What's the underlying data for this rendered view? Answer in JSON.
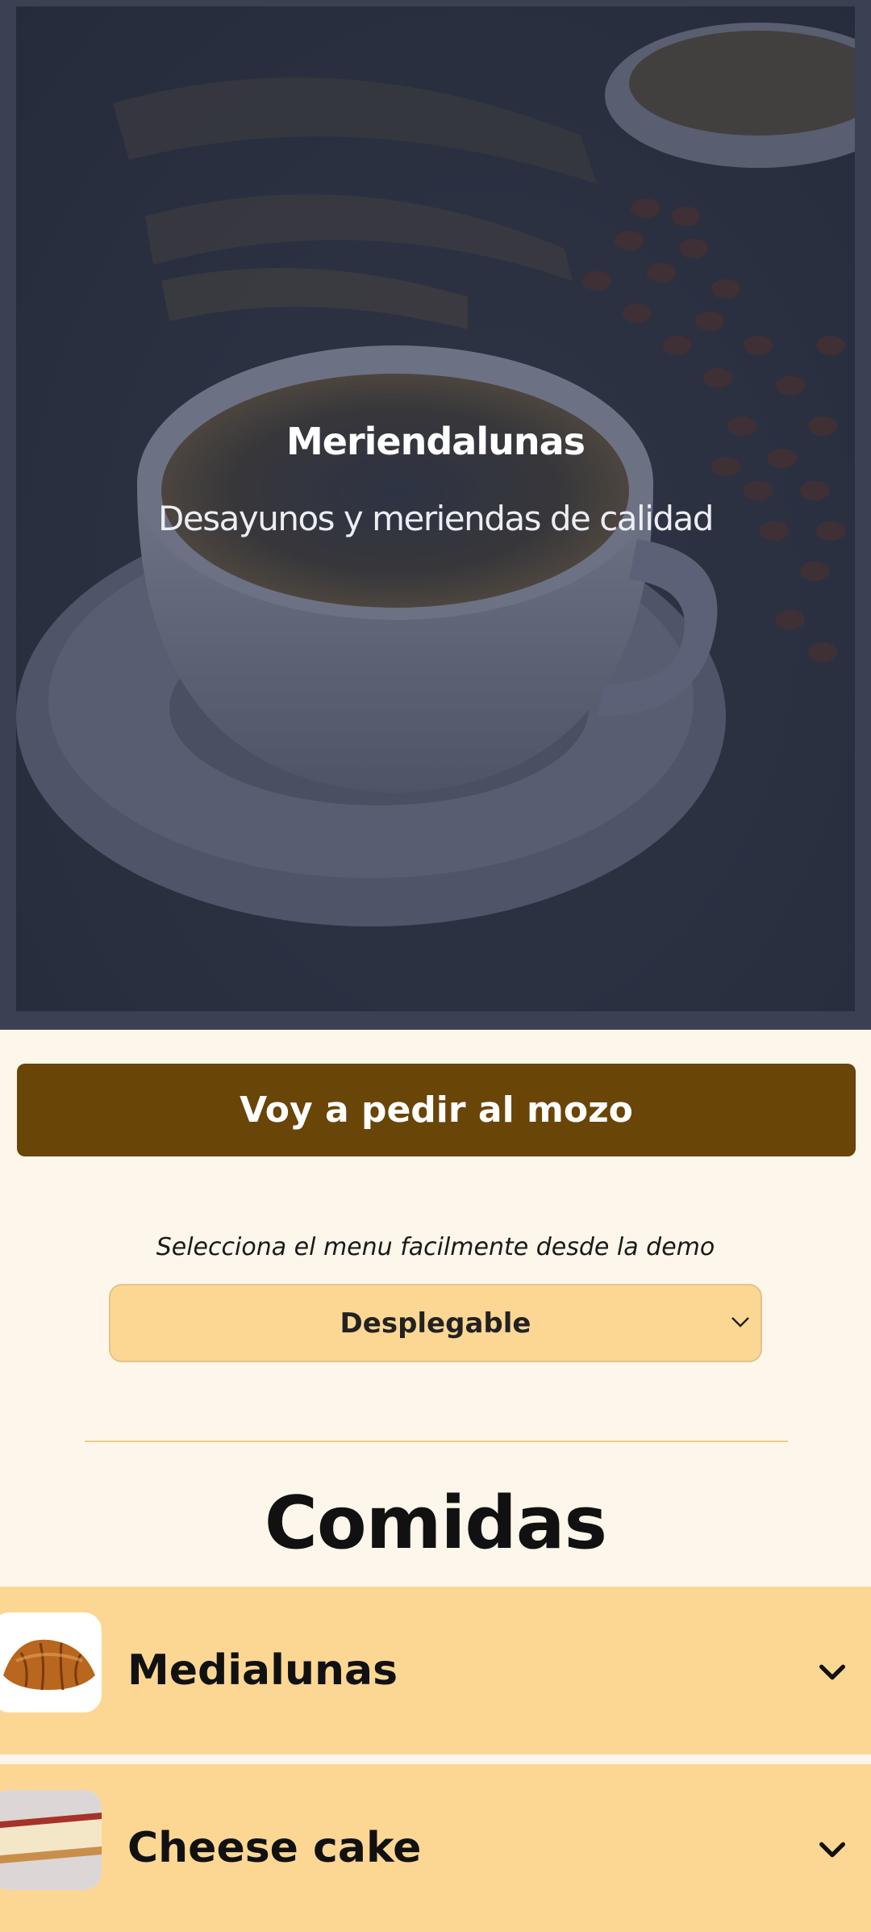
{
  "hero": {
    "title": "Meriendalunas",
    "subtitle": "Desayunos y meriendas de calidad"
  },
  "cta": {
    "label": "Voy a pedir al mozo"
  },
  "menu_select": {
    "hint": "Selecciona el menu facilmente desde la demo",
    "selected": "Desplegable"
  },
  "section": {
    "title": "Comidas"
  },
  "items": [
    {
      "label": "Medialunas",
      "thumb_icon": "croissant-icon"
    },
    {
      "label": "Cheese cake",
      "thumb_icon": "cheesecake-icon"
    }
  ],
  "colors": {
    "background": "#fdf6ea",
    "primary_button": "#6a4508",
    "accent": "#fcd794"
  }
}
